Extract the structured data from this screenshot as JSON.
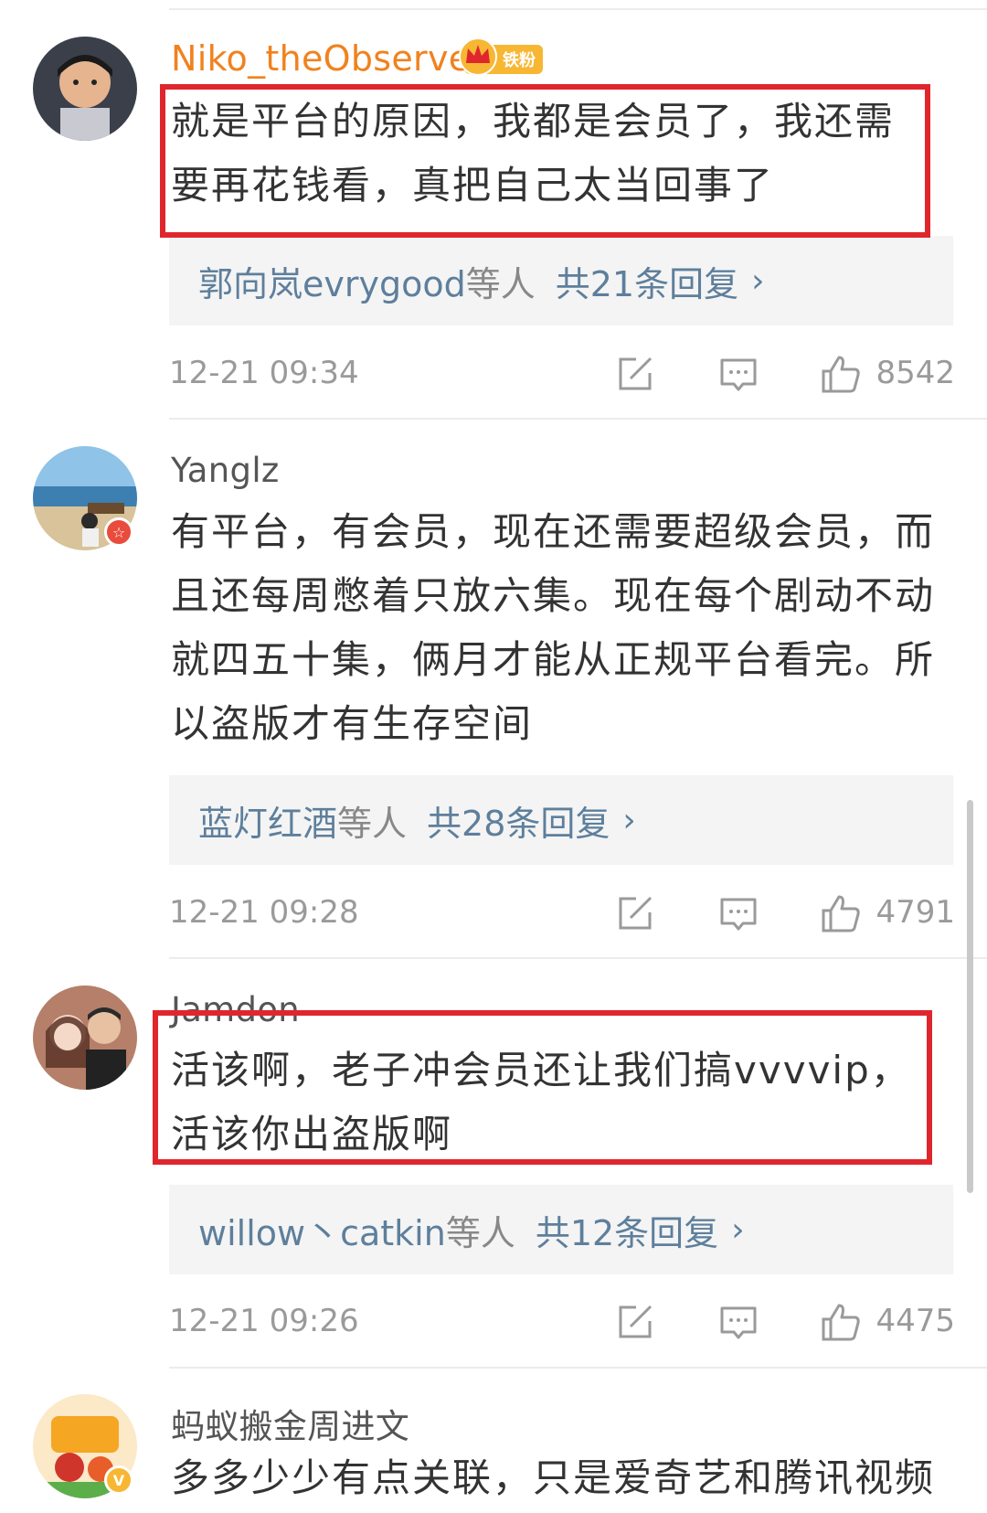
{
  "comments": [
    {
      "username": "Niko_theObserver",
      "badge": "铁粉",
      "text": "就是平台的原因，我都是会员了，我还需要再花钱看，真把自己太当回事了",
      "replies": {
        "users": "郭向岚evrygood",
        "suffix": "等人",
        "count": "共21条回复",
        "chevron": "›"
      },
      "time": "12-21 09:34",
      "likes": "8542"
    },
    {
      "username": "Yanglz",
      "text": "有平台，有会员，现在还需要超级会员，而且还每周憋着只放六集。现在每个剧动不动就四五十集，俩月才能从正规平台看完。所以盗版才有生存空间",
      "replies": {
        "users": "蓝灯红酒",
        "suffix": "等人",
        "count": "共28条回复",
        "chevron": "›"
      },
      "time": "12-21 09:28",
      "likes": "4791"
    },
    {
      "username": "Jamdon",
      "text": "活该啊，老子冲会员还让我们搞vvvvip，活该你出盗版啊",
      "replies": {
        "users": "willow丶catkin",
        "suffix": "等人",
        "count": "共12条回复",
        "chevron": "›"
      },
      "time": "12-21 09:26",
      "likes": "4475"
    },
    {
      "username": "蚂蚁搬金周进文",
      "text": "多多少少有点关联，只是爱奇艺和腾讯视频"
    }
  ],
  "icons": {
    "repost": "repost-icon",
    "comment": "comment-icon",
    "like": "thumbs-up-icon"
  },
  "colors": {
    "highlight": "#e0262d",
    "link": "#5e7f9c",
    "vip_name": "#f0821e"
  }
}
